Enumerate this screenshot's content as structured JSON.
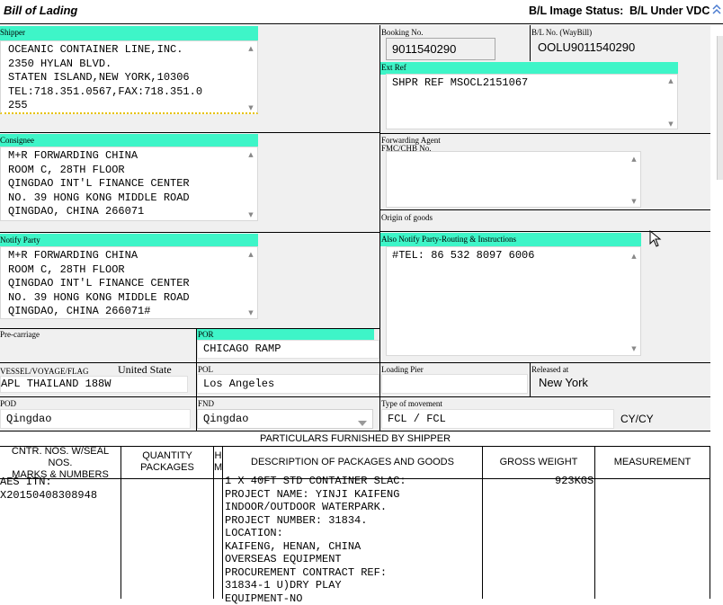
{
  "header": {
    "title": "Bill of Lading",
    "status_label": "B/L Image Status:",
    "status_value": "B/L Under VDC",
    "collapse_icon": "double-chevron-up-icon"
  },
  "shipper": {
    "label": "Shipper",
    "text": "OCEANIC CONTAINER LINE,INC.\n2350 HYLAN BLVD.\nSTATEN ISLAND,NEW YORK,10306\nTEL:718.351.0567,FAX:718.351.0\n255"
  },
  "consignee": {
    "label": "Consignee",
    "text": "M+R FORWARDING CHINA\nROOM C, 28TH FLOOR\nQINGDAO INT'L FINANCE CENTER\nNO. 39 HONG KONG MIDDLE ROAD\nQINGDAO, CHINA 266071"
  },
  "notify_party": {
    "label": "Notify Party",
    "text": "M+R FORWARDING CHINA\nROOM C, 28TH FLOOR\nQINGDAO INT'L FINANCE CENTER\nNO. 39 HONG KONG MIDDLE ROAD\nQINGDAO, CHINA 266071#"
  },
  "booking": {
    "label": "Booking No.",
    "value": "9011540290"
  },
  "bl_no": {
    "label": "B/L No. (WayBill)",
    "value": "OOLU9011540290"
  },
  "ext_ref": {
    "label": "Ext Ref",
    "text": "SHPR REF MSOCL2151067"
  },
  "forwarding_agent": {
    "label": "Forwarding Agent",
    "sublabel": "FMC/CHB No.",
    "text": ""
  },
  "origin": {
    "label": "Origin of goods"
  },
  "also_notify": {
    "label": "Also Notify Party-Routing & Instructions",
    "text": "#TEL: 86 532 8097 6006"
  },
  "pre_carriage": {
    "label": "Pre-carriage"
  },
  "por": {
    "label": "POR",
    "value": "CHICAGO RAMP"
  },
  "vessel": {
    "label": "VESSEL/VOYAGE/FLAG",
    "flag": "United State",
    "value": "APL THAILAND 188W"
  },
  "pol": {
    "label": "POL",
    "value": "Los Angeles"
  },
  "loading_pier": {
    "label": "Loading Pier",
    "value": ""
  },
  "released_at": {
    "label": "Released at",
    "value": "New York"
  },
  "pod": {
    "label": "POD",
    "value": "Qingdao"
  },
  "fnd": {
    "label": "FND",
    "value": "Qingdao"
  },
  "movement": {
    "label": "Type of movement",
    "value": "FCL / FCL",
    "suffix": "CY/CY"
  },
  "particulars": {
    "title": "PARTICULARS FURNISHED BY SHIPPER",
    "columns": {
      "cntr": "CNTR. NOS. W/SEAL NOS.\nMARKS & NUMBERS",
      "qty": "QUANTITY\nPACKAGES",
      "hm": "H\nM",
      "desc": "DESCRIPTION OF PACKAGES AND GOODS",
      "gross": "GROSS WEIGHT",
      "measure": "MEASUREMENT"
    },
    "row": {
      "marks": "AES ITN:\nX20150408308948",
      "description": "1 X 40FT STD CONTAINER SLAC:\nPROJECT NAME: YINJI KAIFENG\nINDOOR/OUTDOOR WATERPARK.\nPROJECT NUMBER: 31834.\nLOCATION:\nKAIFENG, HENAN, CHINA\nOVERSEAS EQUIPMENT\nPROCUREMENT CONTRACT REF:\n31834-1 U)DRY PLAY\nEQUIPMENT-NO",
      "gross_weight": "923KGS"
    }
  }
}
